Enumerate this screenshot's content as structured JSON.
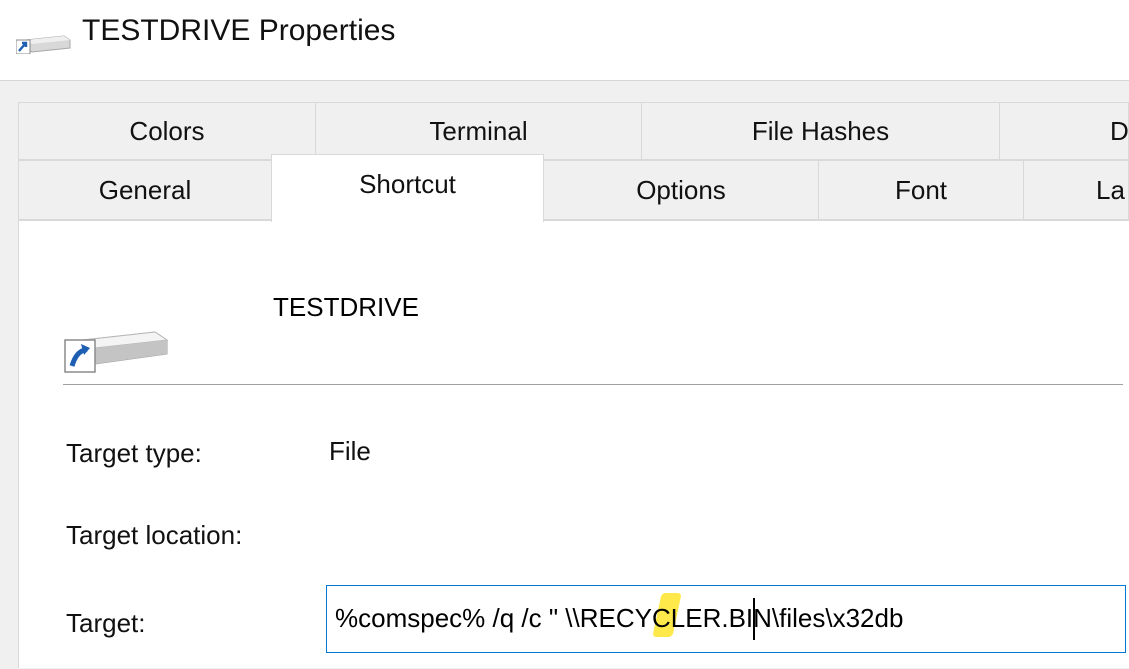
{
  "window": {
    "title": "TESTDRIVE Properties",
    "icon": "drive-shortcut-icon"
  },
  "tabs": {
    "row1": [
      {
        "label": "Colors"
      },
      {
        "label": "Terminal"
      },
      {
        "label": "File Hashes"
      },
      {
        "label": "De"
      }
    ],
    "row2": [
      {
        "label": "General"
      },
      {
        "label": "Shortcut"
      },
      {
        "label": "Options"
      },
      {
        "label": "Font"
      },
      {
        "label": "La"
      }
    ],
    "active": "Shortcut"
  },
  "shortcut": {
    "name": "TESTDRIVE",
    "target_type_label": "Target type:",
    "target_type_value": "File",
    "target_location_label": "Target location:",
    "target_label": "Target:",
    "target_value": "%comspec% /q /c \" \\\\RECYCLER.BIN\\files\\x32db"
  },
  "colors": {
    "accent_border": "#0078d7",
    "highlight": "#ffe94a",
    "tab_bg": "#f0f0f0"
  }
}
